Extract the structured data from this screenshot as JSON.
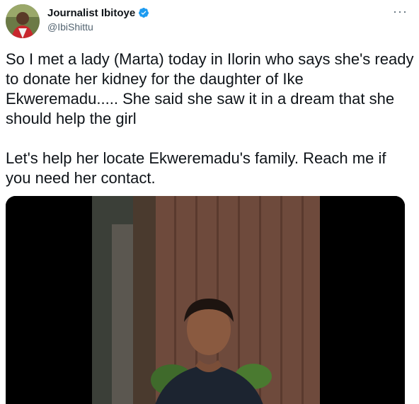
{
  "author": {
    "display_name": "Journalist Ibitoye",
    "handle": "@IbiShittu",
    "verified": true
  },
  "tweet": {
    "paragraph_1": "So I met a lady (Marta) today in Ilorin who says she's ready to donate her kidney for the daughter of Ike Ekweremadu..... She said she saw it in a dream that she should help the girl",
    "paragraph_2": "Let's help her locate Ekweremadu's family. Reach me if you need her contact."
  },
  "colors": {
    "verified_blue": "#1d9bf0",
    "text_primary": "#0f1419",
    "text_secondary": "#536471",
    "media_background": "#000000"
  },
  "icons": {
    "more": "more-horizontal-icon",
    "verified": "verified-badge-icon"
  }
}
